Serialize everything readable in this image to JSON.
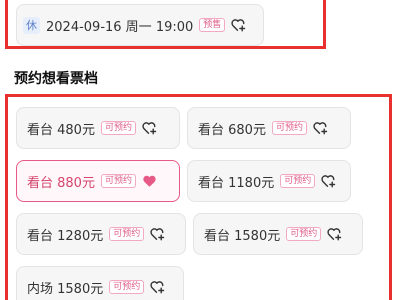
{
  "session": {
    "rest_badge": "休",
    "date_text": "2024-09-16 周一 19:00",
    "tag": "预售",
    "icon": "heart-add-icon"
  },
  "tiers_section": {
    "title": "预约想看票档",
    "tiers": [
      {
        "label": "看台 480元",
        "tag": "可预约",
        "selected": false,
        "icon": "heart-add-icon"
      },
      {
        "label": "看台 680元",
        "tag": "可预约",
        "selected": false,
        "icon": "heart-add-icon"
      },
      {
        "label": "看台 880元",
        "tag": "可预约",
        "selected": true,
        "icon": "heart-filled-icon"
      },
      {
        "label": "看台 1180元",
        "tag": "可预约",
        "selected": false,
        "icon": "heart-add-icon"
      },
      {
        "label": "看台 1280元",
        "tag": "可预约",
        "selected": false,
        "icon": "heart-add-icon"
      },
      {
        "label": "看台 1580元",
        "tag": "可预约",
        "selected": false,
        "icon": "heart-add-icon"
      },
      {
        "label": "内场 1580元",
        "tag": "可预约",
        "selected": false,
        "icon": "heart-add-icon"
      }
    ]
  },
  "colors": {
    "highlight_frame": "#e8312f",
    "accent_pink": "#e85a86",
    "tag_pink": "#e0608a"
  }
}
